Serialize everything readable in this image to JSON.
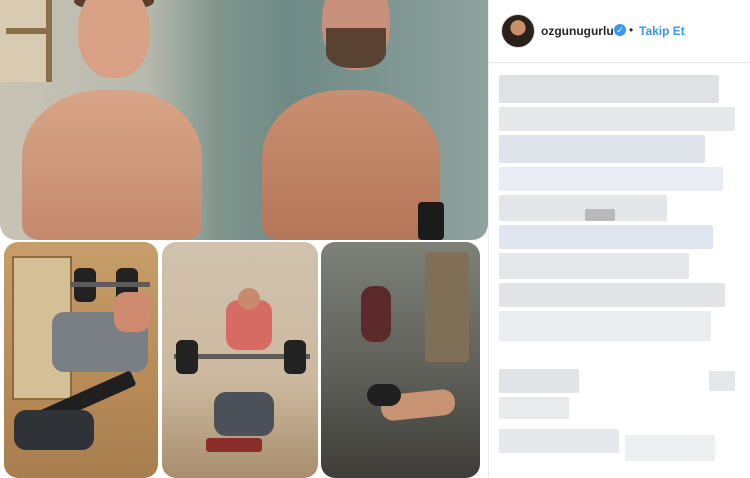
{
  "post": {
    "author": {
      "username": "ozgunugurlu",
      "verified_icon": "verified-badge-icon",
      "separator": "•",
      "follow_label": "Takip Et"
    },
    "caption_state": "blurred"
  },
  "colors": {
    "accent": "#3897f0",
    "text": "#262626",
    "border": "#eaeaea"
  }
}
